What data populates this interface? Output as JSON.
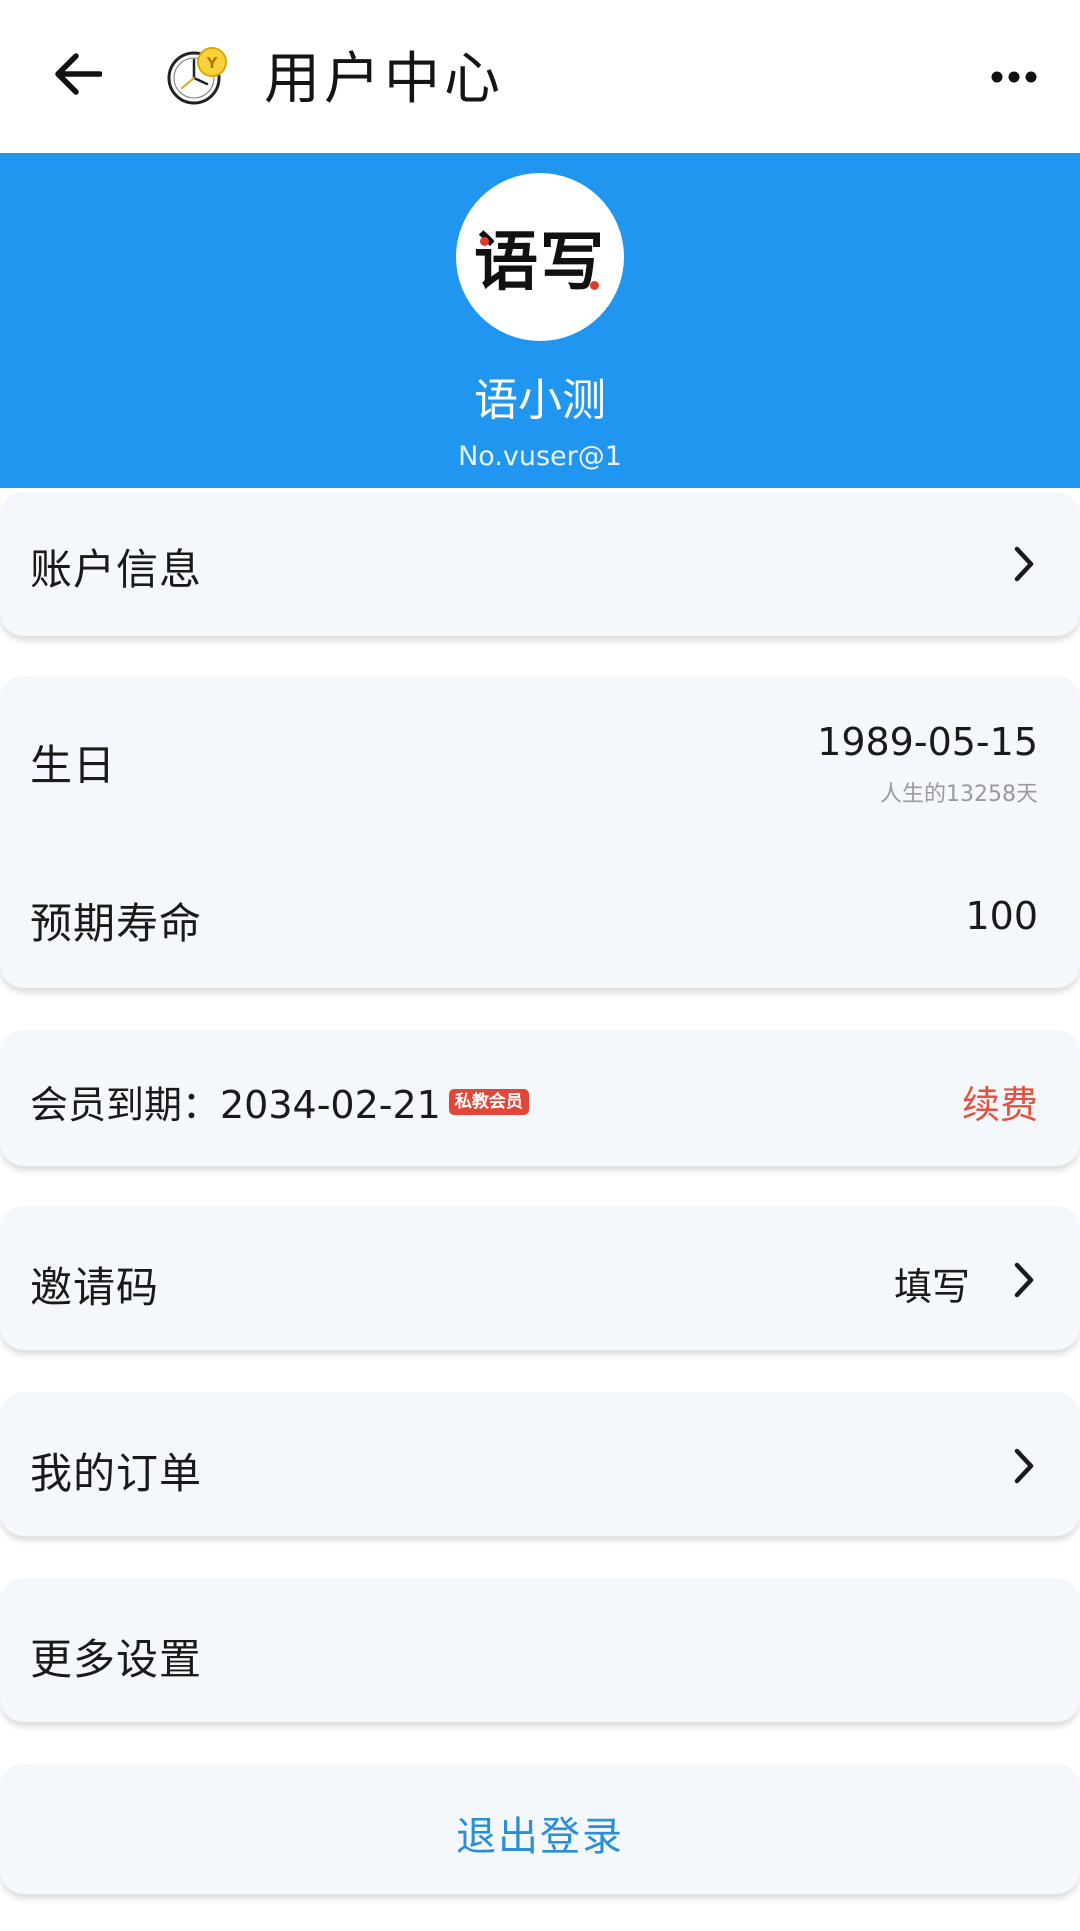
{
  "appbar": {
    "title": "用户中心",
    "back_icon": "arrow-left-icon",
    "logo_icon": "clock-coin-logo-icon",
    "more_icon": "more-horizontal-icon"
  },
  "profile": {
    "avatar_text": "语写",
    "name": "语小测",
    "user_id": "No.vuser@1"
  },
  "account": {
    "label": "账户信息"
  },
  "life": {
    "birthday_label": "生日",
    "birthday_value": "1989-05-15",
    "days_note": "人生的13258天",
    "lifespan_label": "预期寿命",
    "lifespan_value": "100"
  },
  "membership": {
    "expiry_text": "会员到期：2034-02-21",
    "badge": "私教会员",
    "renew_label": "续费"
  },
  "invite": {
    "label": "邀请码",
    "action": "填写"
  },
  "orders": {
    "label": "我的订单"
  },
  "settings": {
    "label": "更多设置"
  },
  "logout": {
    "label": "退出登录"
  },
  "colors": {
    "banner": "#2196f0",
    "card_bg": "#f4f7fb",
    "renew": "#e5503f",
    "badge": "#e2463a",
    "logout": "#2b8fd6"
  }
}
